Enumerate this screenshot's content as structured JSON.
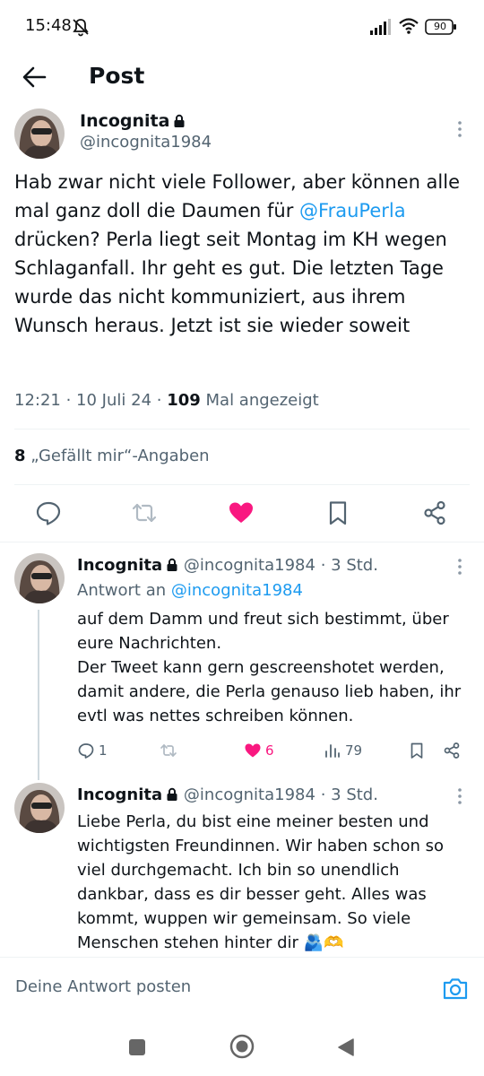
{
  "status_bar": {
    "time": "15:48",
    "battery": "90"
  },
  "header": {
    "title": "Post"
  },
  "tweet": {
    "display_name": "Incognita",
    "handle": "@incognita1984",
    "text_before_mention": "Hab zwar nicht viele Follower, aber können alle mal ganz doll die Daumen für ",
    "mention": "@FrauPerla",
    "text_after_mention": " drücken? Perla liegt seit Montag im KH wegen Schlaganfall. Ihr geht es gut. Die letzten Tage wurde das nicht kommuniziert, aus ihrem Wunsch heraus. Jetzt ist sie wieder soweit",
    "time": "12:21",
    "date": "10 Juli 24",
    "views_count": "109",
    "views_label": "Mal angezeigt",
    "likes_count": "8",
    "likes_label": "„Gefällt mir“-Angaben"
  },
  "replies": [
    {
      "display_name": "Incognita",
      "handle": "@incognita1984",
      "age": "3 Std.",
      "reply_to_label": "Antwort an",
      "reply_to_handle": "@incognita1984",
      "text": "auf dem Damm und freut sich bestimmt, über eure Nachrichten.\nDer Tweet kann gern gescreenshotet werden, damit andere, die Perla genauso lieb haben, ihr evtl was nettes schreiben können.",
      "reply_count": "1",
      "like_count": "6",
      "view_count": "79"
    },
    {
      "display_name": "Incognita",
      "handle": "@incognita1984",
      "age": "3 Std.",
      "text": "Liebe Perla, du bist eine meiner besten und wichtigsten Freundinnen. Wir haben schon so viel durchgemacht. Ich bin so unendlich dankbar, dass es dir besser geht. Alles was kommt, wuppen wir gemeinsam. So viele Menschen stehen hinter dir 🫂🫶"
    }
  ],
  "compose": {
    "placeholder": "Deine Antwort posten"
  },
  "colors": {
    "accent": "#1d9bf0",
    "like": "#f91880",
    "secondary_text": "#536471"
  }
}
